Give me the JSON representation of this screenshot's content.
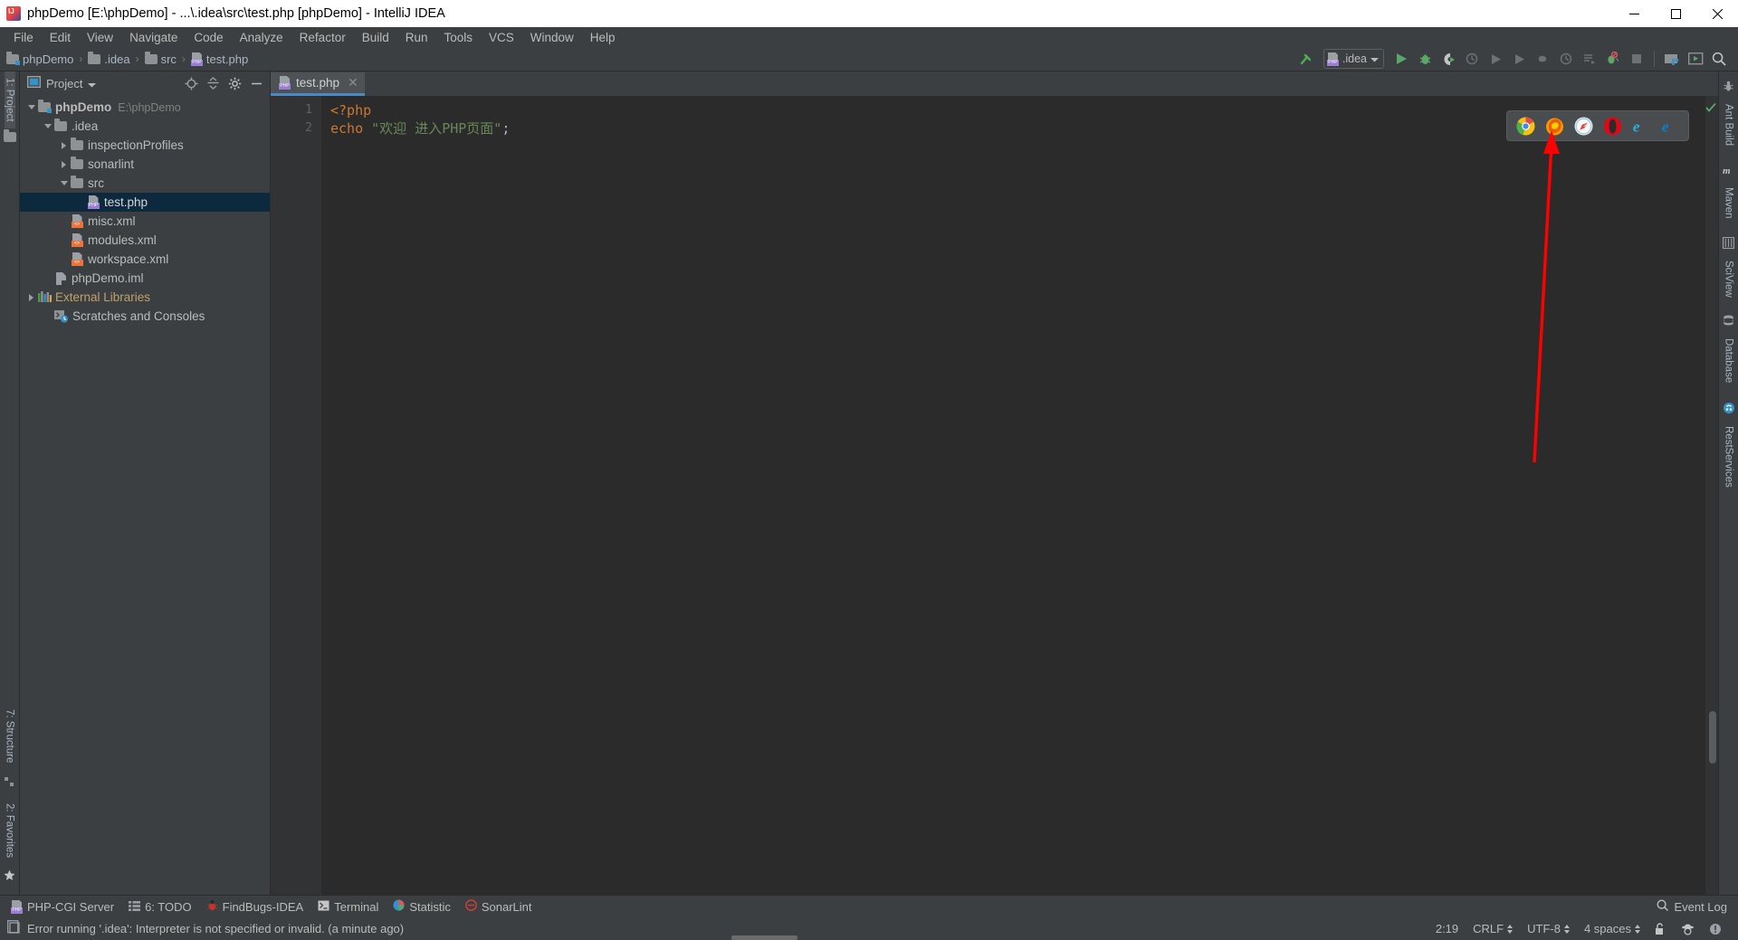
{
  "window": {
    "title": "phpDemo [E:\\phpDemo] - ...\\.idea\\src\\test.php [phpDemo] - IntelliJ IDEA",
    "app_icon": "intellij-idea-icon",
    "controls": {
      "minimize": "minimize-icon",
      "maximize": "maximize-icon",
      "close": "close-icon"
    }
  },
  "menubar": {
    "items": [
      {
        "label": "File"
      },
      {
        "label": "Edit"
      },
      {
        "label": "View"
      },
      {
        "label": "Navigate"
      },
      {
        "label": "Code"
      },
      {
        "label": "Analyze"
      },
      {
        "label": "Refactor"
      },
      {
        "label": "Build"
      },
      {
        "label": "Run"
      },
      {
        "label": "Tools"
      },
      {
        "label": "VCS"
      },
      {
        "label": "Window"
      },
      {
        "label": "Help"
      }
    ]
  },
  "navbar": {
    "breadcrumbs": [
      {
        "label": "phpDemo",
        "icon": "module-folder-icon"
      },
      {
        "label": ".idea",
        "icon": "folder-icon"
      },
      {
        "label": "src",
        "icon": "folder-icon"
      },
      {
        "label": "test.php",
        "icon": "php-file-icon"
      }
    ],
    "separator": "›",
    "run_config": {
      "label": ".idea",
      "icon": "php-file-icon",
      "dropdown": "chevron-down-icon"
    },
    "actions": [
      {
        "name": "build-hammer-icon"
      },
      {
        "name": "run-icon"
      },
      {
        "name": "debug-icon"
      },
      {
        "name": "run-with-coverage-icon"
      },
      {
        "name": "profile-icon"
      },
      {
        "name": "run-dashboard-icon"
      },
      {
        "name": "rerun-icon"
      },
      {
        "name": "stop-icon"
      },
      {
        "name": "attach-process-icon"
      },
      {
        "name": "todo-list-icon"
      },
      {
        "name": "debug-breakpoint-mute-icon"
      },
      {
        "name": "stop-square-icon"
      },
      {
        "name": "project-structure-icon"
      },
      {
        "name": "update-project-icon"
      },
      {
        "name": "search-everywhere-icon"
      }
    ]
  },
  "left_strip": {
    "top": [
      {
        "label": "1: Project",
        "active": true,
        "icon": "project-icon"
      }
    ],
    "bottom": [
      {
        "label": "7: Structure",
        "icon": "structure-icon"
      },
      {
        "label": "2: Favorites",
        "icon": "favorites-star-icon"
      }
    ]
  },
  "project_panel": {
    "title": "Project",
    "dropdown": "chevron-down-icon",
    "actions": [
      {
        "name": "locate-target-icon"
      },
      {
        "name": "collapse-all-icon"
      },
      {
        "name": "settings-gear-icon"
      },
      {
        "name": "hide-panel-icon"
      }
    ],
    "tree": [
      {
        "label": "phpDemo",
        "sub": "E:\\phpDemo",
        "depth": 0,
        "arrow": "down",
        "icon": "module-folder-icon",
        "selected": false
      },
      {
        "label": ".idea",
        "sub": "",
        "depth": 1,
        "arrow": "down",
        "icon": "folder-icon",
        "selected": false
      },
      {
        "label": "inspectionProfiles",
        "sub": "",
        "depth": 2,
        "arrow": "right",
        "icon": "folder-icon",
        "selected": false
      },
      {
        "label": "sonarlint",
        "sub": "",
        "depth": 2,
        "arrow": "right",
        "icon": "folder-icon",
        "selected": false
      },
      {
        "label": "src",
        "sub": "",
        "depth": 2,
        "arrow": "down",
        "icon": "folder-icon",
        "selected": false
      },
      {
        "label": "test.php",
        "sub": "",
        "depth": 3,
        "arrow": "none",
        "icon": "php-file-icon",
        "selected": true
      },
      {
        "label": "misc.xml",
        "sub": "",
        "depth": 2,
        "arrow": "none",
        "icon": "xml-file-icon",
        "selected": false
      },
      {
        "label": "modules.xml",
        "sub": "",
        "depth": 2,
        "arrow": "none",
        "icon": "xml-file-icon",
        "selected": false
      },
      {
        "label": "workspace.xml",
        "sub": "",
        "depth": 2,
        "arrow": "none",
        "icon": "xml-file-icon",
        "selected": false
      },
      {
        "label": "phpDemo.iml",
        "sub": "",
        "depth": 1,
        "arrow": "none",
        "icon": "iml-file-icon",
        "selected": false
      },
      {
        "label": "External Libraries",
        "sub": "",
        "depth": 0,
        "arrow": "right",
        "icon": "libraries-icon",
        "selected": false,
        "orange": true
      },
      {
        "label": "Scratches and Consoles",
        "sub": "",
        "depth": 0,
        "arrow": "none",
        "icon": "scratches-icon",
        "selected": false
      }
    ]
  },
  "editor": {
    "tabs": [
      {
        "label": "test.php",
        "icon": "php-file-icon",
        "close": "close-icon",
        "active": true
      }
    ],
    "lines": [
      {
        "number": "1",
        "tokens": [
          {
            "text": "<?php",
            "type": "tag"
          }
        ]
      },
      {
        "number": "2",
        "tokens": [
          {
            "text": "echo",
            "type": "kw"
          },
          {
            "text": " ",
            "type": "punc"
          },
          {
            "text": "\"欢迎 进入PHP页面\"",
            "type": "str"
          },
          {
            "text": ";",
            "type": "punc"
          }
        ]
      }
    ],
    "inspection_status": "no-errors-checkmark-icon",
    "browser_popup": {
      "browsers": [
        {
          "name": "chrome-icon",
          "color": "#4285f4"
        },
        {
          "name": "firefox-icon",
          "color": "#e66000"
        },
        {
          "name": "safari-icon",
          "color": "#1b9df0"
        },
        {
          "name": "opera-icon",
          "color": "#e30613"
        },
        {
          "name": "internet-explorer-icon",
          "color": "#28b0e6"
        },
        {
          "name": "edge-icon",
          "color": "#0b7fd4"
        }
      ]
    },
    "annotation": {
      "name": "red-arrow-annotation",
      "color": "#ff0000"
    }
  },
  "right_strip": {
    "tabs": [
      {
        "label": "Ant Build",
        "icon": "ant-icon"
      },
      {
        "label": "Maven",
        "icon": "maven-icon"
      },
      {
        "label": "SciView",
        "icon": "sciview-icon"
      },
      {
        "label": "Database",
        "icon": "database-icon"
      },
      {
        "label": "RestServices",
        "icon": "rest-services-icon"
      }
    ]
  },
  "toolwindow_bar": {
    "items": [
      {
        "label": "PHP-CGI Server",
        "icon": "php-file-icon"
      },
      {
        "label": "6: TODO",
        "icon": "todo-icon"
      },
      {
        "label": "FindBugs-IDEA",
        "icon": "findbugs-icon"
      },
      {
        "label": "Terminal",
        "icon": "terminal-icon"
      },
      {
        "label": "Statistic",
        "icon": "statistic-icon"
      },
      {
        "label": "SonarLint",
        "icon": "sonarlint-icon"
      }
    ],
    "event_log": {
      "label": "Event Log",
      "icon": "event-log-icon"
    }
  },
  "statusbar": {
    "message": "Error running '.idea': Interpreter is not specified or invalid. (a minute ago)",
    "message_icon": "notification-icon",
    "caret_position": "2:19",
    "line_separator": "CRLF",
    "encoding": "UTF-8",
    "indent": "4 spaces",
    "icons": [
      {
        "name": "lock-unlocked-icon"
      },
      {
        "name": "hector-inspection-icon"
      },
      {
        "name": "background-tasks-icon"
      }
    ]
  },
  "colors": {
    "background": "#3c3f41",
    "editor_background": "#2b2b2b",
    "selection": "#0d293e",
    "accent": "#4a88c7",
    "text": "#bbbbbb",
    "code_keyword": "#cc7832",
    "code_string": "#6a8759",
    "annotation_red": "#ff0000"
  }
}
